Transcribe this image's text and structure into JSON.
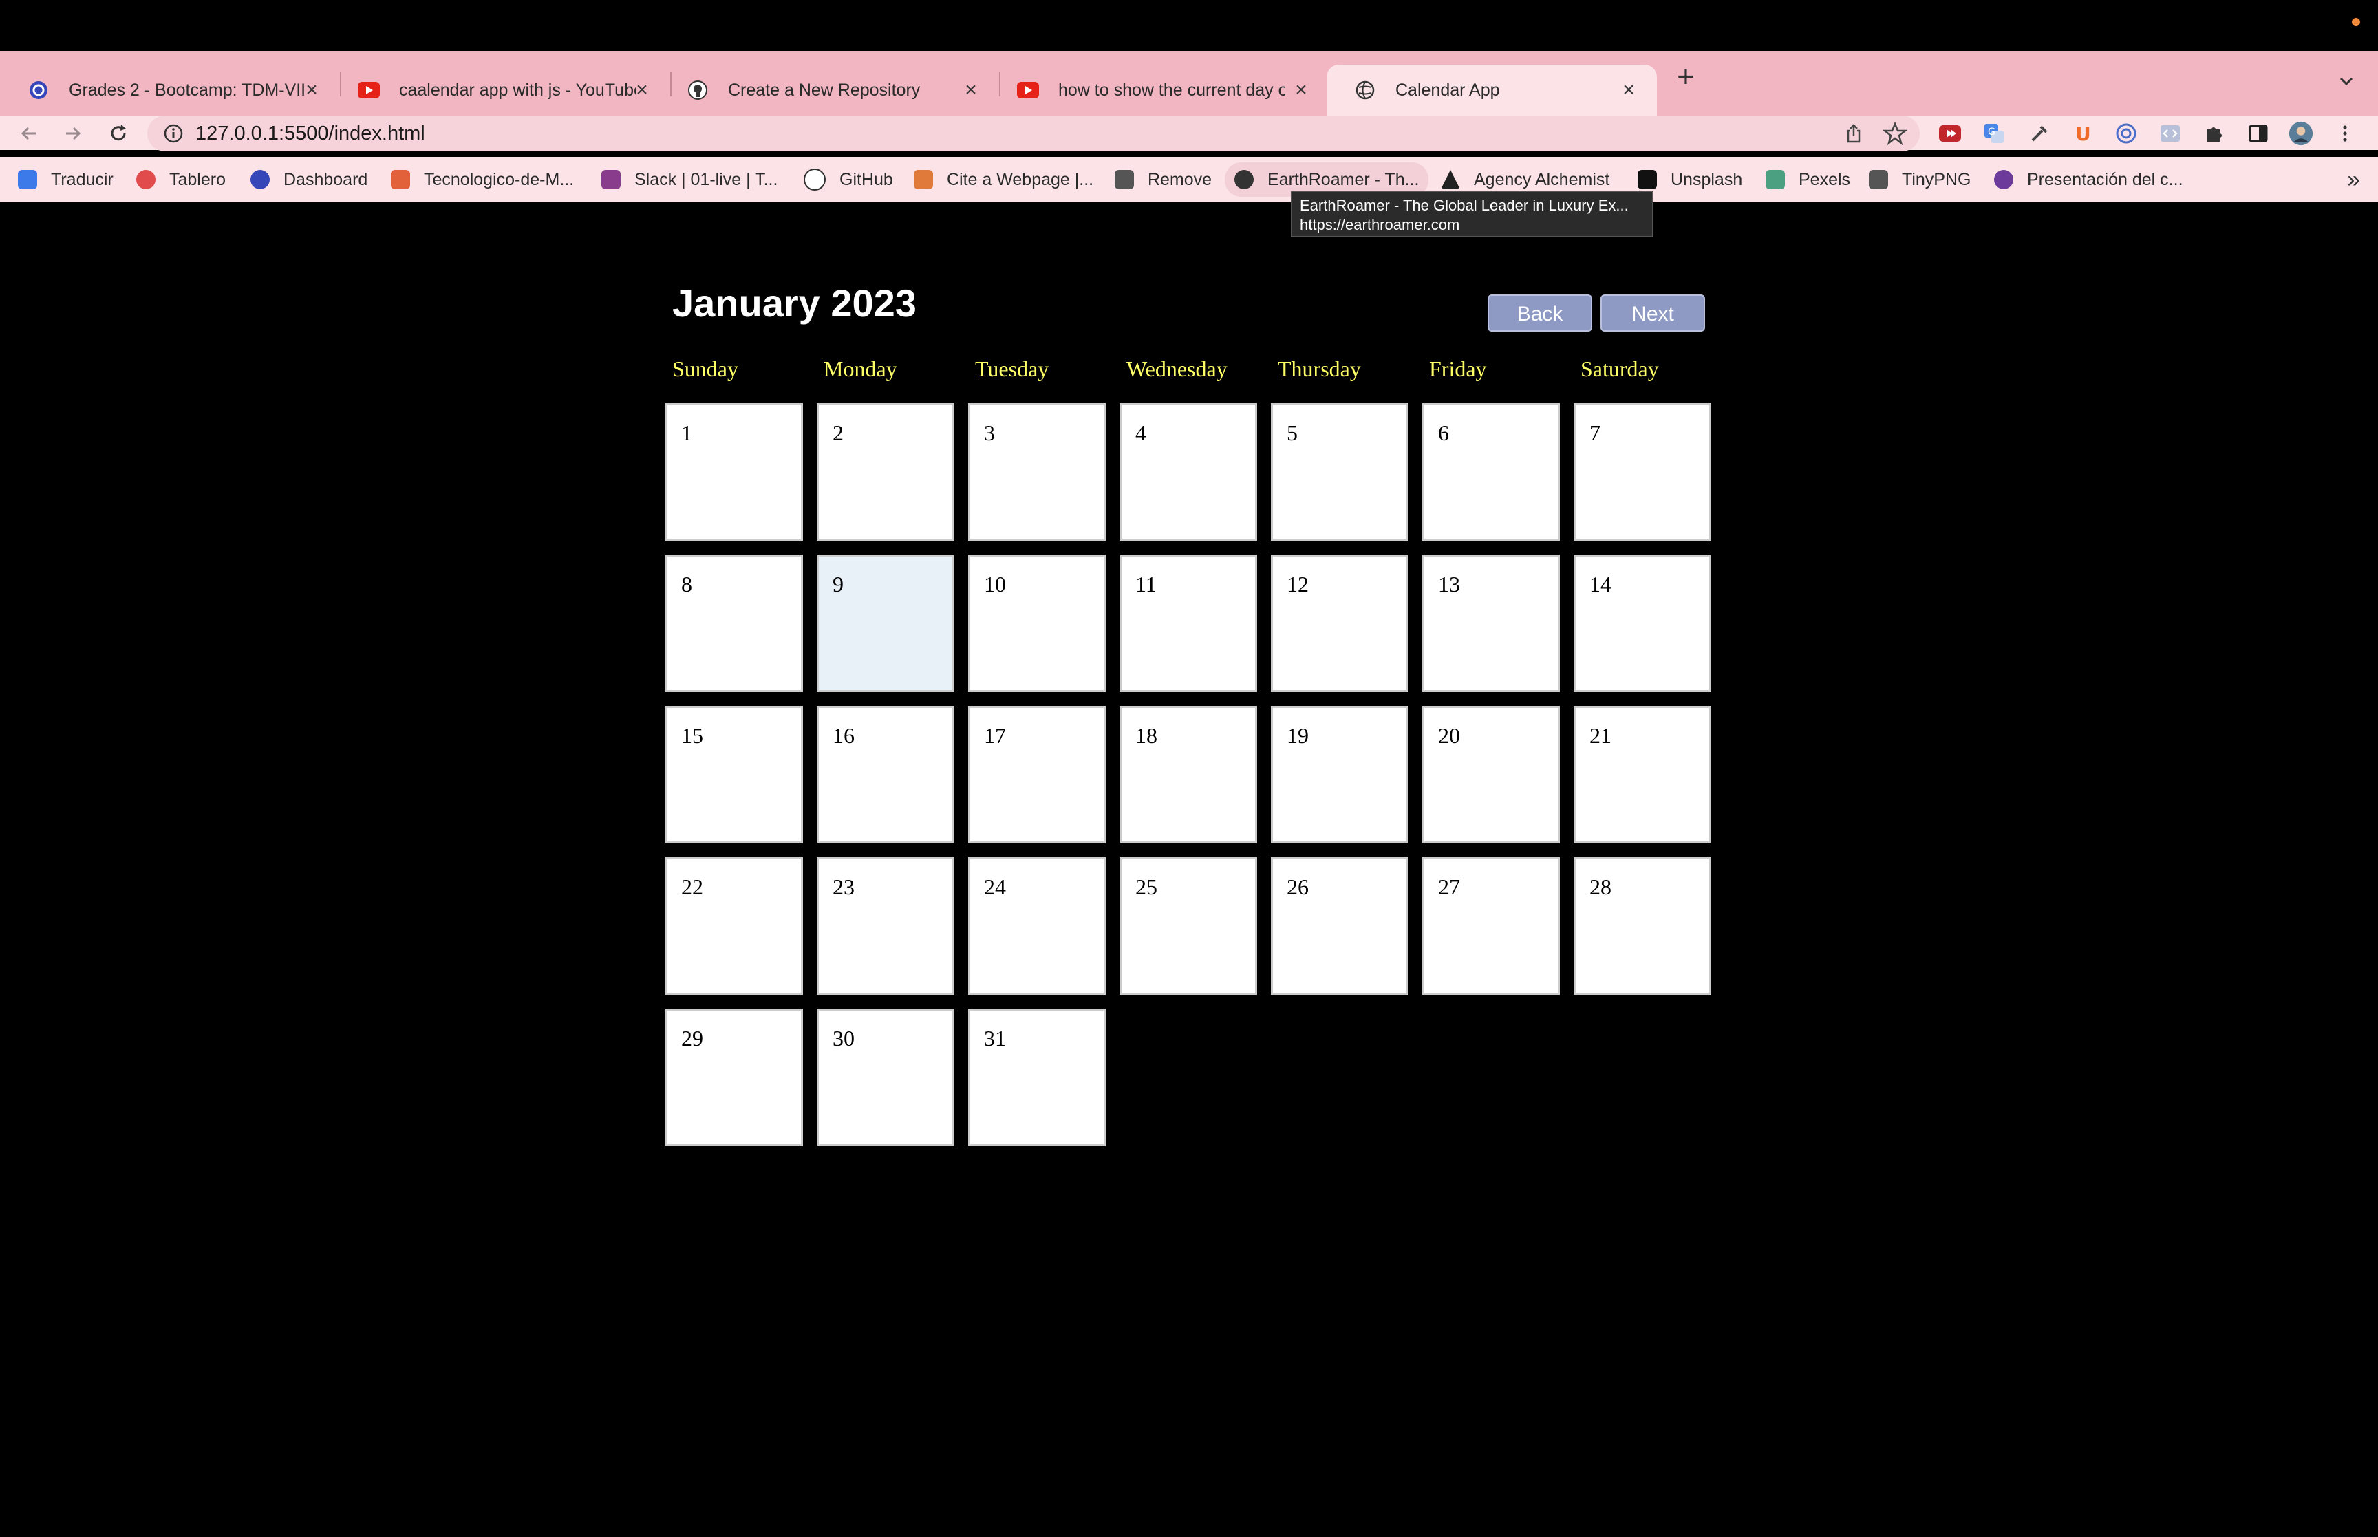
{
  "browser": {
    "tabs": [
      {
        "title": "Grades 2 - Bootcamp: TDM-VII",
        "icon": "grades-icon",
        "active": false
      },
      {
        "title": "caalendar app with js - YouTube",
        "icon": "youtube-icon",
        "active": false
      },
      {
        "title": "Create a New Repository",
        "icon": "github-icon",
        "active": false
      },
      {
        "title": "how to show the current day on",
        "icon": "youtube-icon",
        "active": false
      },
      {
        "title": "Calendar App",
        "icon": "globe-icon",
        "active": true
      }
    ],
    "url": "127.0.0.1:5500/index.html",
    "bookmarks": [
      {
        "label": "Traducir",
        "icon": "translate-icon",
        "color": "#3b7ae8"
      },
      {
        "label": "Tablero",
        "icon": "tablero-icon",
        "color": "#e24b4b"
      },
      {
        "label": "Dashboard",
        "icon": "dashboard-icon",
        "color": "#3547b8"
      },
      {
        "label": "Tecnologico-de-M...",
        "icon": "gitlab-icon",
        "color": "#e2603a"
      },
      {
        "label": "Slack | 01-live | T...",
        "icon": "slack-icon",
        "color": "#8a3c8c"
      },
      {
        "label": "GitHub",
        "icon": "github-icon",
        "color": "#2a2a2a"
      },
      {
        "label": "Cite a Webpage |...",
        "icon": "cite-icon",
        "color": "#e07a3a"
      },
      {
        "label": "Remove",
        "icon": "remove-icon",
        "color": "#2a2a2a"
      },
      {
        "label": "EarthRoamer - Th...",
        "icon": "earthroamer-icon",
        "color": "#2a2a2a"
      },
      {
        "label": "Agency Alchemist",
        "icon": "alchemist-icon",
        "color": "#2a2a2a"
      },
      {
        "label": "Unsplash",
        "icon": "unsplash-icon",
        "color": "#2a2a2a"
      },
      {
        "label": "Pexels",
        "icon": "pexels-icon",
        "color": "#4aa080"
      },
      {
        "label": "TinyPNG",
        "icon": "tinypng-icon",
        "color": "#2a2a2a"
      },
      {
        "label": "Presentación del c...",
        "icon": "presentation-icon",
        "color": "#6b3a9a"
      }
    ],
    "tooltip": {
      "title": "EarthRoamer - The Global Leader in Luxury Ex...",
      "url": "https://earthroamer.com"
    }
  },
  "calendar": {
    "title": "January 2023",
    "back_label": "Back",
    "next_label": "Next",
    "weekdays": [
      "Sunday",
      "Monday",
      "Tuesday",
      "Wednesday",
      "Thursday",
      "Friday",
      "Saturday"
    ],
    "days": [
      "1",
      "2",
      "3",
      "4",
      "5",
      "6",
      "7",
      "8",
      "9",
      "10",
      "11",
      "12",
      "13",
      "14",
      "15",
      "16",
      "17",
      "18",
      "19",
      "20",
      "21",
      "22",
      "23",
      "24",
      "25",
      "26",
      "27",
      "28",
      "29",
      "30",
      "31"
    ],
    "today": "9",
    "colors": {
      "weekday": "#ffff66",
      "button": "#8f9ac4",
      "today": "#e8f0f8"
    }
  }
}
